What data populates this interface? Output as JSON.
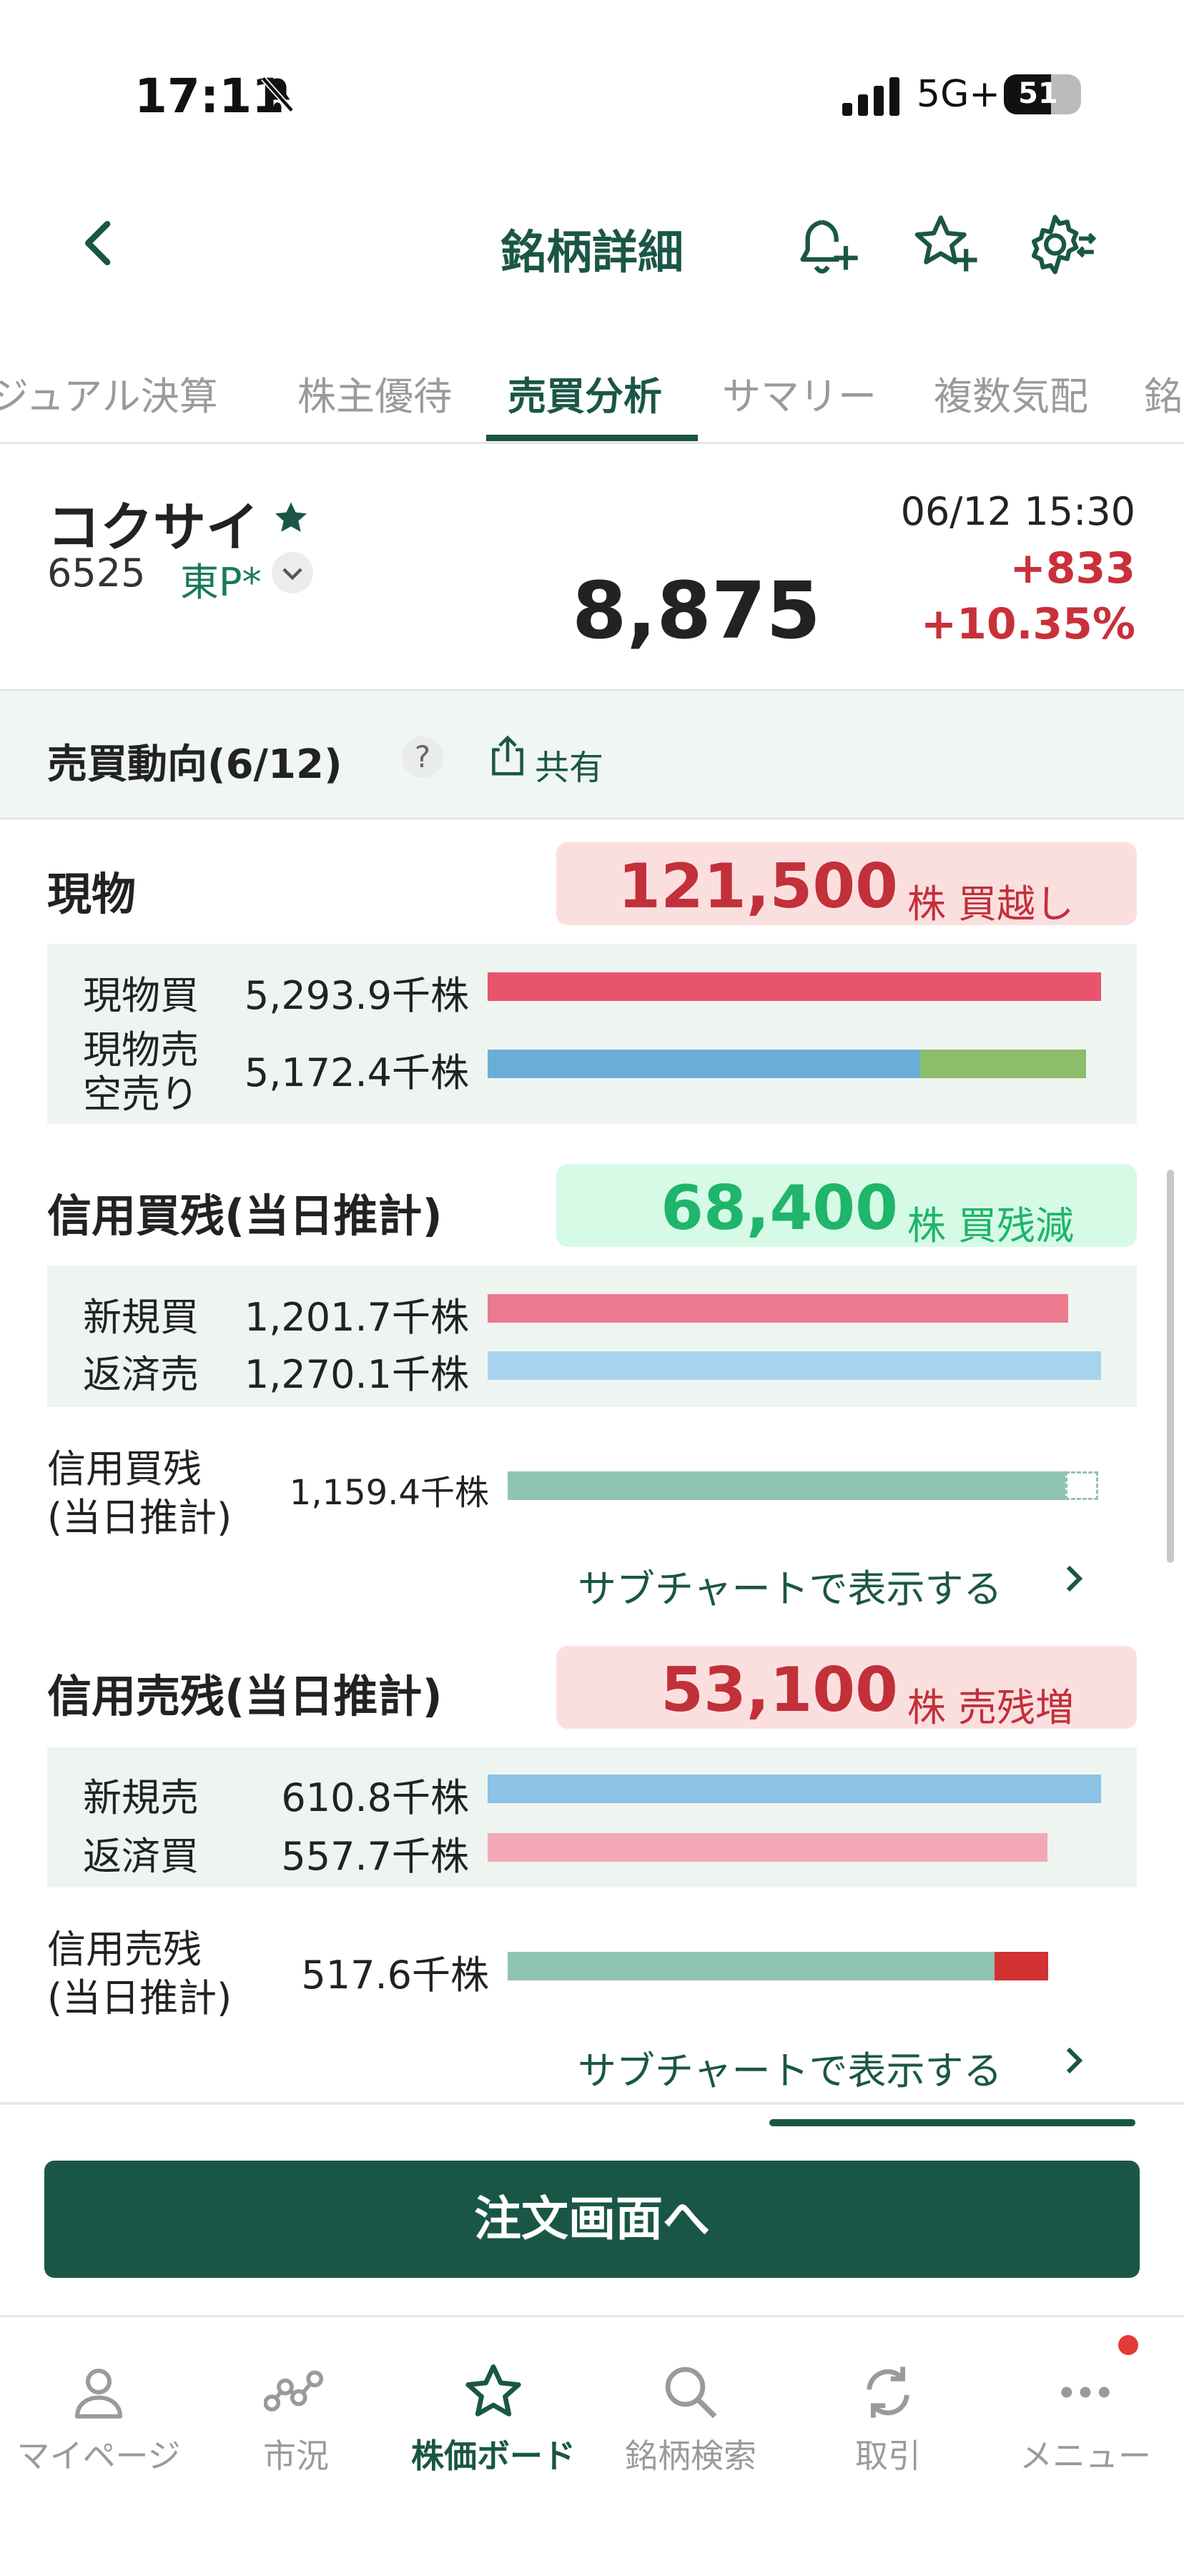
{
  "status_bar": {
    "time": "17:11",
    "network": "5G+",
    "battery": "51"
  },
  "header": {
    "title": "銘柄詳細"
  },
  "tabs": [
    {
      "label": "ジュアル決算",
      "active": false
    },
    {
      "label": "株主優待",
      "active": false
    },
    {
      "label": "売買分析",
      "active": true
    },
    {
      "label": "サマリー",
      "active": false
    },
    {
      "label": "複数気配",
      "active": false
    },
    {
      "label": "銘",
      "active": false
    }
  ],
  "stock": {
    "name": "コクサイ",
    "code": "6525",
    "market": "東P*",
    "price": "8,875",
    "datetime": "06/12 15:30",
    "change": "+833",
    "change_pct": "+10.35%"
  },
  "trend": {
    "title": "売買動向(6/12)",
    "help": "?",
    "share_label": "共有"
  },
  "genbutsu": {
    "title": "現物",
    "badge_value": "121,500",
    "badge_unit": "株 買越し",
    "buy_label": "現物買",
    "buy_value": "5,293.9千株",
    "buy_ratio": 1.0,
    "sell_label_1": "現物売",
    "sell_label_2": "空売り",
    "sell_value": "5,172.4千株",
    "sell_genbutsu_ratio": 0.705,
    "sell_karauri_ratio": 0.27,
    "colors": {
      "buy": "#e8546d",
      "sell": "#6aaed8",
      "karauri": "#8cbd6a"
    }
  },
  "margin_buy": {
    "title": "信用買残(当日推計)",
    "badge_value": "68,400",
    "badge_unit": "株 買残減",
    "new_label": "新規買",
    "new_value": "1,201.7千株",
    "new_ratio": 0.946,
    "repay_label": "返済売",
    "repay_value": "1,270.1千株",
    "repay_ratio": 1.0,
    "balance_label_1": "信用買残",
    "balance_label_2": "(当日推計)",
    "balance_value": "1,159.4千株",
    "balance_ratio": 0.94,
    "subchart_label": "サブチャートで表示する"
  },
  "margin_sell": {
    "title": "信用売残(当日推計)",
    "badge_value": "53,100",
    "badge_unit": "株 売残増",
    "new_label": "新規売",
    "new_value": "610.8千株",
    "new_ratio": 1.0,
    "repay_label": "返済買",
    "repay_value": "557.7千株",
    "repay_ratio": 0.913,
    "balance_label_1": "信用売残",
    "balance_label_2": "(当日推計)",
    "balance_value": "517.6千株",
    "balance_ratio": 0.82,
    "balance_increase_ratio": 0.09,
    "subchart_label": "サブチャートで表示する"
  },
  "order_button": "注文画面へ",
  "bottom_nav": [
    {
      "label": "マイページ",
      "icon": "person-icon",
      "active": false
    },
    {
      "label": "市況",
      "icon": "market-graph-icon",
      "active": false
    },
    {
      "label": "株価ボード",
      "icon": "star-icon",
      "active": true
    },
    {
      "label": "銘柄検索",
      "icon": "search-icon",
      "active": false
    },
    {
      "label": "取引",
      "icon": "refresh-icon",
      "active": false
    },
    {
      "label": "メニュー",
      "icon": "more-icon",
      "active": false
    }
  ],
  "colors": {
    "brand": "#1a5646",
    "up": "#c9303a",
    "down_green": "#1fb56a"
  }
}
